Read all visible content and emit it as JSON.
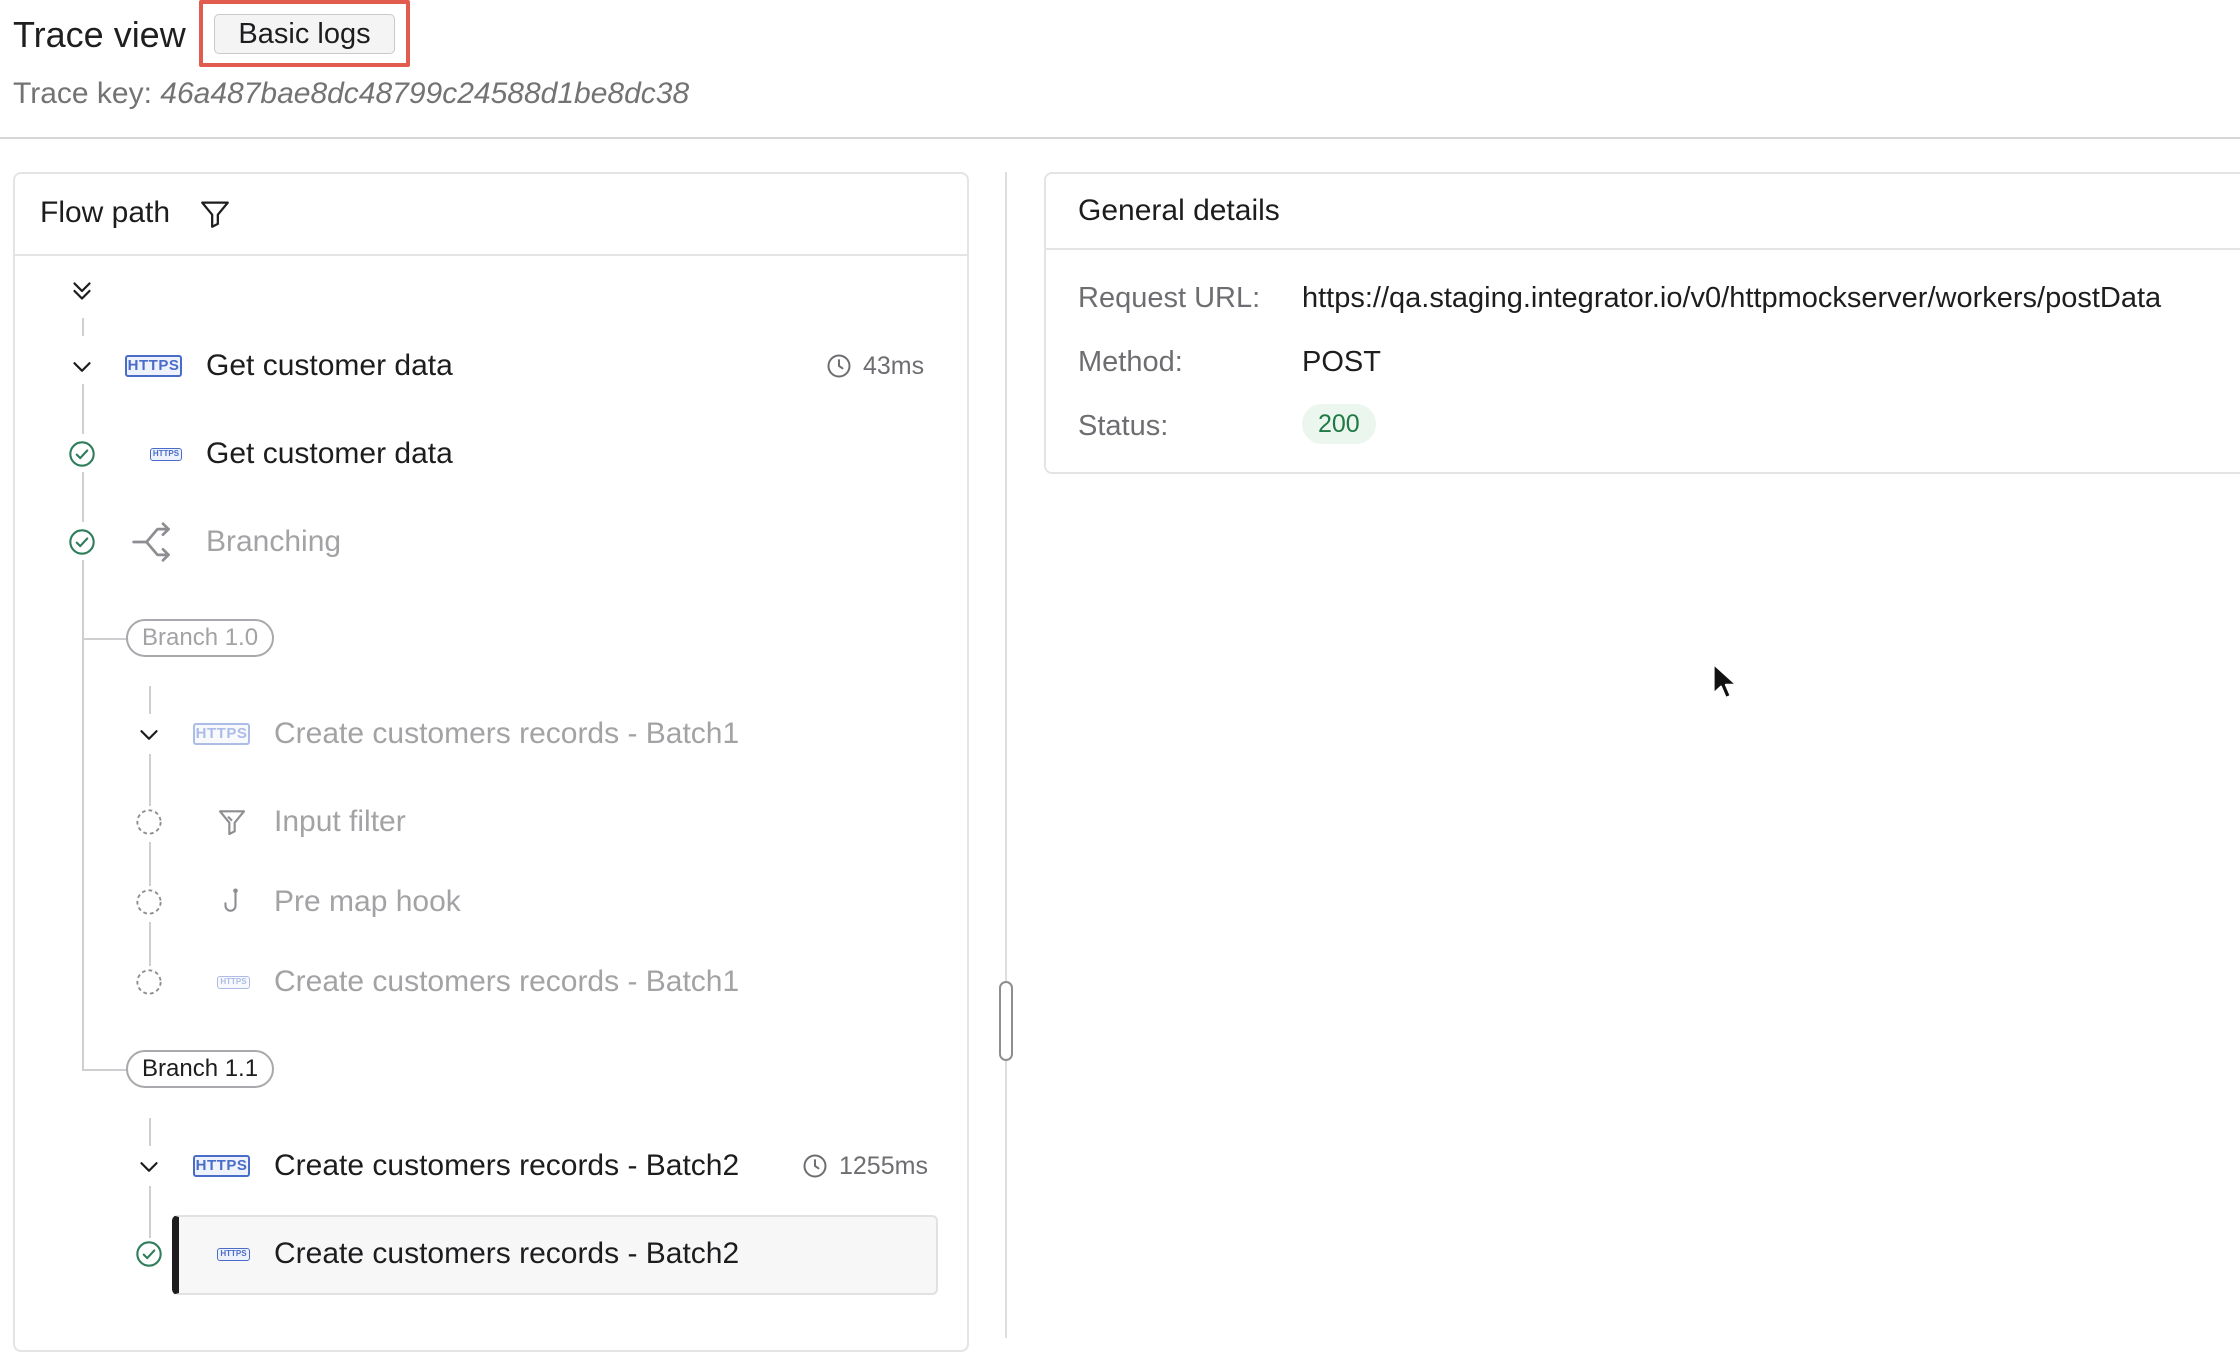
{
  "header": {
    "title": "Trace view",
    "basic_logs_label": "Basic logs",
    "trace_key_label": "Trace key:",
    "trace_key_value": "46a487bae8dc48799c24588d1be8dc38"
  },
  "flow_panel": {
    "title": "Flow path",
    "rows": [
      {
        "label": "Get customer data",
        "duration": "43ms",
        "type": "HTTPS",
        "state": "expanded"
      },
      {
        "label": "Get customer data",
        "type": "HTTPS",
        "status": "success"
      },
      {
        "label": "Branching",
        "status": "success"
      },
      {
        "label": "Create customers records - Batch1",
        "type": "HTTPS",
        "state": "expanded"
      },
      {
        "label": "Input filter",
        "status": "pending"
      },
      {
        "label": "Pre map hook",
        "status": "pending"
      },
      {
        "label": "Create customers records - Batch1",
        "type": "HTTPS",
        "status": "pending"
      },
      {
        "label": "Create customers records - Batch2",
        "duration": "1255ms",
        "type": "HTTPS",
        "state": "expanded"
      },
      {
        "label": "Create customers records - Batch2",
        "type": "HTTPS",
        "status": "success",
        "selected": true
      }
    ],
    "branches": [
      "Branch 1.0",
      "Branch 1.1"
    ],
    "https_badge": "HTTPS"
  },
  "details": {
    "title": "General details",
    "request_url_label": "Request URL:",
    "request_url": "https://qa.staging.integrator.io/v0/httpmockserver/workers/postData",
    "method_label": "Method:",
    "method": "POST",
    "status_label": "Status:",
    "status": "200"
  },
  "colors": {
    "highlight_border": "#e25b4f",
    "https_blue": "#4a6cc9",
    "success_green": "#2e7d5b",
    "status_badge_bg": "#eaf6ee"
  }
}
